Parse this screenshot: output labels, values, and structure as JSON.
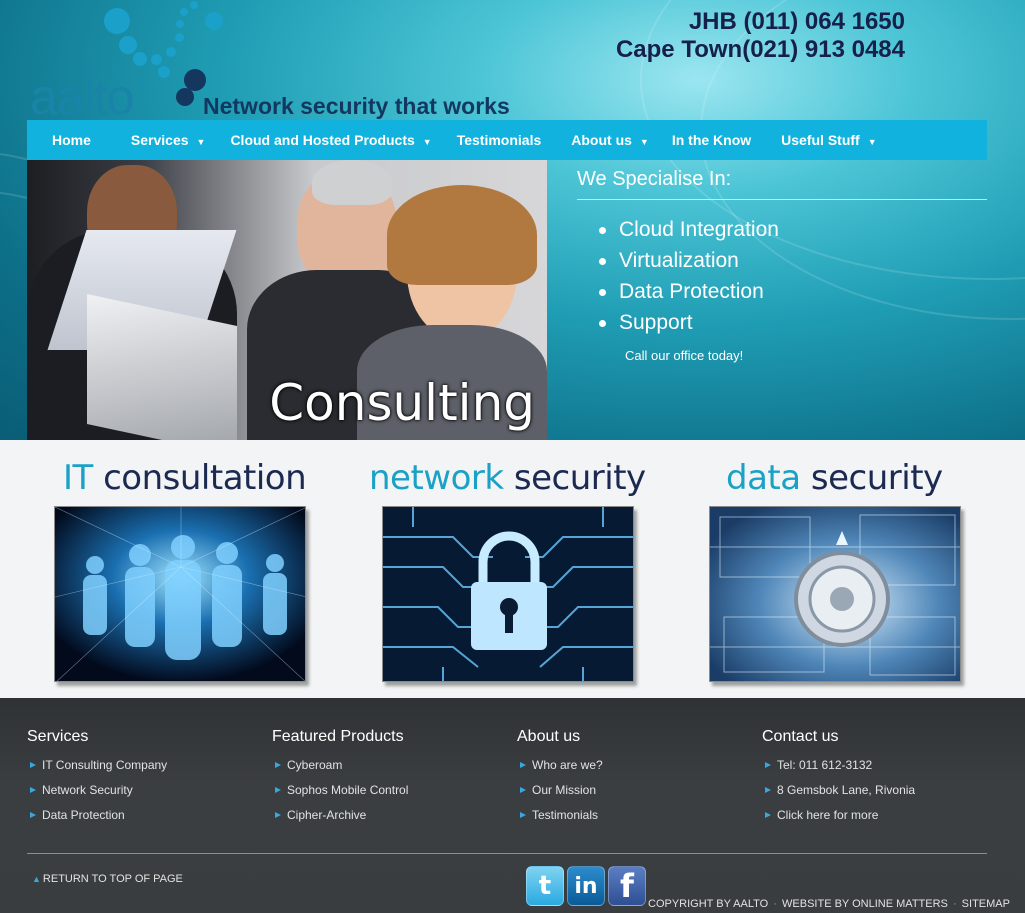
{
  "header": {
    "logo_text": "aalto",
    "tagline": "Network security that works",
    "phones": [
      {
        "city": "JHB",
        "number": "(011) 064 1650"
      },
      {
        "city": "Cape Town",
        "number": "(021) 913 0484"
      }
    ]
  },
  "nav": {
    "items": [
      {
        "label": "Home",
        "has_dropdown": false
      },
      {
        "label": "Services",
        "has_dropdown": true
      },
      {
        "label": "Cloud and Hosted Products",
        "has_dropdown": true
      },
      {
        "label": "Testimonials",
        "has_dropdown": false
      },
      {
        "label": "About us",
        "has_dropdown": true
      },
      {
        "label": "In the Know",
        "has_dropdown": false
      },
      {
        "label": "Useful Stuff",
        "has_dropdown": true
      }
    ],
    "caret": "▼"
  },
  "hero": {
    "caption": "Consulting",
    "heading": "We Specialise In:",
    "items": [
      "Cloud Integration",
      "Virtualization",
      "Data Protection",
      "Support"
    ],
    "cta": "Call our office today!"
  },
  "features": [
    {
      "title_a": "IT ",
      "title_b": "consultation",
      "image": "digital-people-image"
    },
    {
      "title_a": "network ",
      "title_b": "security",
      "image": "circuit-padlock-image"
    },
    {
      "title_a": "data ",
      "title_b": "security",
      "image": "data-vault-image"
    }
  ],
  "footer": {
    "columns": [
      {
        "title": "Services",
        "links": [
          "IT Consulting Company",
          "Network Security",
          "Data Protection"
        ]
      },
      {
        "title": "Featured Products",
        "links": [
          "Cyberoam",
          "Sophos Mobile Control",
          "Cipher-Archive"
        ]
      },
      {
        "title": "About us",
        "links": [
          "Who are we?",
          "Our Mission",
          "Testimonials"
        ]
      },
      {
        "title": "Contact us",
        "links": [
          "Tel: 011 612-3132",
          "8 Gemsbok Lane, Rivonia",
          "Click here for more"
        ]
      }
    ],
    "to_top": "RETURN TO TOP OF PAGE",
    "social": {
      "twitter": "t",
      "linkedin": "in",
      "facebook": "f"
    },
    "copyright": "COPYRIGHT BY AALTO",
    "website_by": "WEBSITE BY ONLINE MATTERS",
    "sitemap": "SITEMAP",
    "sep": "·"
  },
  "colors": {
    "nav_bg": "#11b3de",
    "brand_teal": "#1aa1c6",
    "brand_navy": "#1c2a52",
    "footer_bg": "#3a3d3f",
    "footer_bullet": "#36a9e1"
  }
}
